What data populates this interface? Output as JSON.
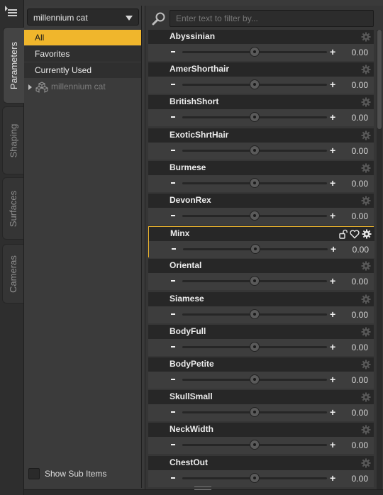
{
  "side_tabs": [
    {
      "label": "Parameters",
      "active": true
    },
    {
      "label": "Shaping",
      "active": false
    },
    {
      "label": "Surfaces",
      "active": false
    },
    {
      "label": "Cameras",
      "active": false
    }
  ],
  "preset": {
    "selected": "millennium cat"
  },
  "tree": {
    "items": [
      {
        "label": "All",
        "selected": true
      },
      {
        "label": "Favorites",
        "selected": false
      },
      {
        "label": "Currently Used",
        "selected": false
      }
    ],
    "node_label": "millennium cat"
  },
  "show_sub_items": {
    "label": "Show Sub Items",
    "checked": false
  },
  "filter": {
    "placeholder": "Enter text to filter by..."
  },
  "colors": {
    "accent": "#f0b62c"
  },
  "parameters": [
    {
      "name": "Abyssinian",
      "value": "0.00",
      "slider": 0.5
    },
    {
      "name": "AmerShorthair",
      "value": "0.00",
      "slider": 0.5
    },
    {
      "name": "BritishShort",
      "value": "0.00",
      "slider": 0.5
    },
    {
      "name": "ExoticShrtHair",
      "value": "0.00",
      "slider": 0.5
    },
    {
      "name": "Burmese",
      "value": "0.00",
      "slider": 0.5
    },
    {
      "name": "DevonRex",
      "value": "0.00",
      "slider": 0.5
    },
    {
      "name": "Minx",
      "value": "0.00",
      "slider": 0.5,
      "highlighted": true
    },
    {
      "name": "Oriental",
      "value": "0.00",
      "slider": 0.5
    },
    {
      "name": "Siamese",
      "value": "0.00",
      "slider": 0.5
    },
    {
      "name": "BodyFull",
      "value": "0.00",
      "slider": 0.5
    },
    {
      "name": "BodyPetite",
      "value": "0.00",
      "slider": 0.5
    },
    {
      "name": "SkullSmall",
      "value": "0.00",
      "slider": 0.5
    },
    {
      "name": "NeckWidth",
      "value": "0.00",
      "slider": 0.5
    },
    {
      "name": "ChestOut",
      "value": "0.00",
      "slider": 0.5
    }
  ],
  "param_controls": {
    "minus": "-",
    "plus": "+"
  },
  "highlight_icons": [
    "lock-icon",
    "heart-icon",
    "gear-icon"
  ]
}
